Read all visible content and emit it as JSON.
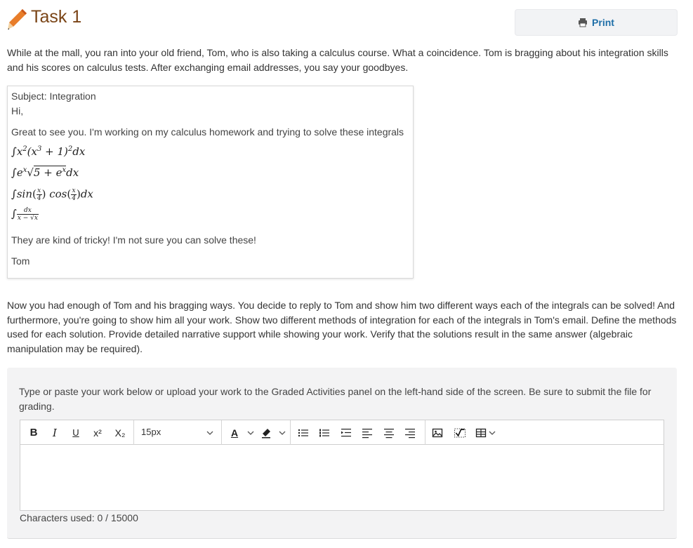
{
  "header": {
    "title": "Task 1",
    "print_label": "Print"
  },
  "intro": "While at the mall, you ran into your old friend, Tom, who is also taking a calculus course. What a coincidence. Tom is bragging about his integration skills and his scores on calculus tests. After exchanging email addresses, you say your goodbyes.",
  "email": {
    "subject": "Subject: Integration",
    "greeting": "Hi,",
    "body": "Great to see you. I'm working on my calculus homework and trying to solve these integrals",
    "closing": "They are kind of tricky! I'm not sure you can solve these!",
    "signature": "Tom",
    "integrals": {
      "i1": {
        "a": "∫",
        "b": "x",
        "c": "2",
        "d": "(x",
        "e": "3",
        "f": " + 1)",
        "g": "2",
        "h": "dx"
      },
      "i2": {
        "a": "∫",
        "b": "e",
        "c": "x",
        "d": "√",
        "e": "5 + e",
        "f": "x",
        "g": "dx"
      },
      "i3": {
        "a": "∫",
        "b": "sin",
        "c": "(",
        "d": "x",
        "e": "4",
        "f": ")",
        "g": "cos",
        "h": "(",
        "i": "x",
        "j": "4",
        "k": ")",
        "l": "dx"
      },
      "i4": {
        "a": "∫",
        "b": "dx",
        "c": "x − √x"
      }
    }
  },
  "instructions": "Now you had enough of Tom and his bragging ways. You decide to reply to Tom and show him two different ways each of the integrals can be solved! And furthermore, you're going to show him all your work. Show two different methods of integration for each of the integrals in Tom's email. Define the methods used for each solution. Provide detailed narrative support while showing your work. Verify that the solutions result in the same answer (algebraic manipulation may be required).",
  "submission": {
    "instruction": "Type or paste your work below or upload your work to the Graded Activities panel on the left-hand side of the screen. Be sure to submit the file for grading.",
    "toolbar": {
      "bold": "B",
      "italic": "I",
      "underline": "U",
      "superscript": "x²",
      "subscript": "X₂",
      "font_size": "15px",
      "font_color": "A"
    },
    "counter": "Characters used: 0 / 15000"
  },
  "colors": {
    "title": "#7a4416",
    "link": "#1f6fa8",
    "panel": "#f3f3f4"
  }
}
